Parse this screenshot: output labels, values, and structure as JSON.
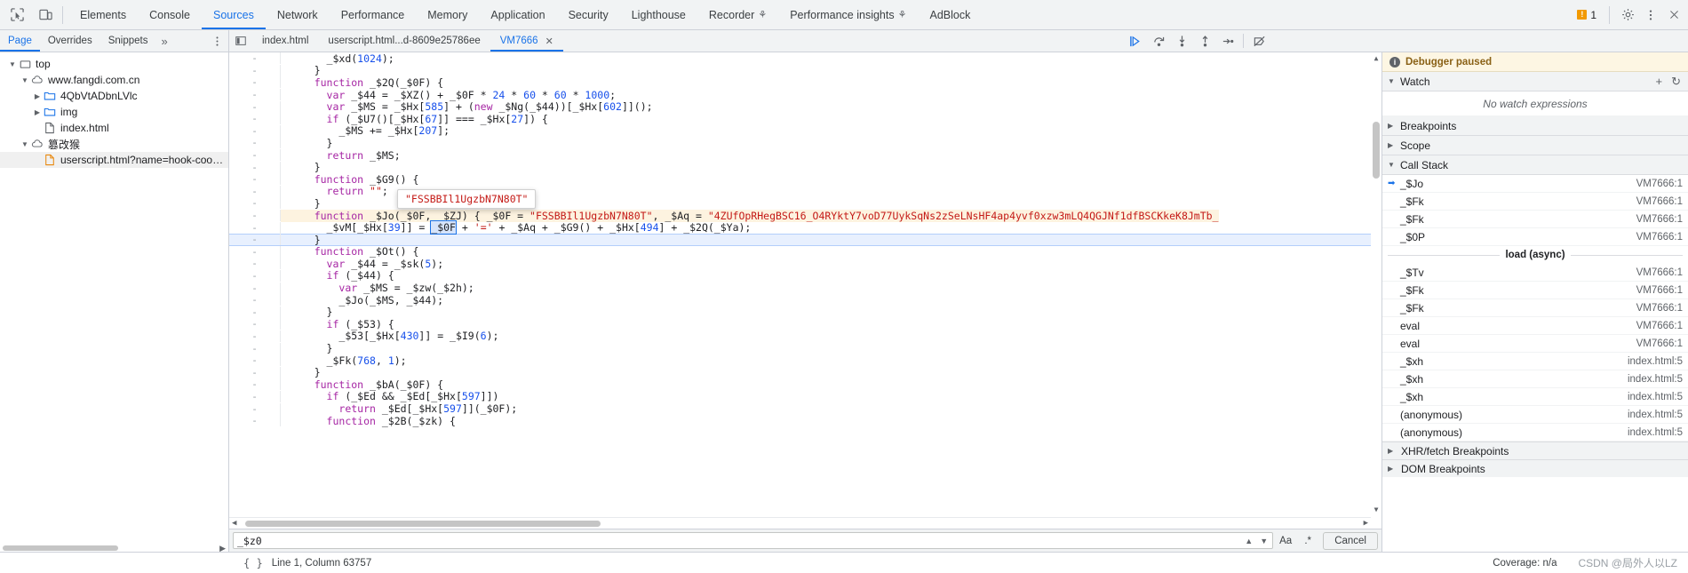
{
  "topbar": {
    "inspect_icon": "inspect-element-icon",
    "device_icon": "device-toolbar-icon",
    "tabs": [
      {
        "label": "Elements",
        "active": false,
        "flask": false
      },
      {
        "label": "Console",
        "active": false,
        "flask": false
      },
      {
        "label": "Sources",
        "active": true,
        "flask": false
      },
      {
        "label": "Network",
        "active": false,
        "flask": false
      },
      {
        "label": "Performance",
        "active": false,
        "flask": false
      },
      {
        "label": "Memory",
        "active": false,
        "flask": false
      },
      {
        "label": "Application",
        "active": false,
        "flask": false
      },
      {
        "label": "Security",
        "active": false,
        "flask": false
      },
      {
        "label": "Lighthouse",
        "active": false,
        "flask": false
      },
      {
        "label": "Recorder",
        "active": false,
        "flask": true
      },
      {
        "label": "Performance insights",
        "active": false,
        "flask": true
      },
      {
        "label": "AdBlock",
        "active": false,
        "flask": false
      }
    ],
    "warning_count": "1",
    "settings_icon": "gear-icon",
    "more_icon": "kebab-menu-icon",
    "close_icon": "close-icon"
  },
  "subbar": {
    "nav_tabs": [
      {
        "label": "Page",
        "active": true
      },
      {
        "label": "Overrides",
        "active": false
      },
      {
        "label": "Snippets",
        "active": false
      }
    ],
    "more_tabs_label": "»",
    "kebab_icon": "kebab-menu-icon",
    "panel_toggle_icon": "show-navigator-icon",
    "editor_tabs": [
      {
        "label": "index.html",
        "active": false,
        "closable": false
      },
      {
        "label": "userscript.html...d-8609e25786ee",
        "active": false,
        "closable": false
      },
      {
        "label": "VM7666",
        "active": true,
        "closable": true
      }
    ],
    "close_tab_glyph": "✕",
    "debug_controls": [
      {
        "name": "resume-script-execution",
        "glyph": "▷"
      },
      {
        "name": "step-over-next-function-call",
        "glyph": "↷"
      },
      {
        "name": "step-into-next-function-call",
        "glyph": "↓"
      },
      {
        "name": "step-out-of-current-function",
        "glyph": "↑"
      },
      {
        "name": "step",
        "glyph": "→"
      },
      {
        "name": "deactivate-breakpoints",
        "glyph": "⊘"
      }
    ]
  },
  "navigator": {
    "tree": [
      {
        "label": "top",
        "depth": 0,
        "twisty": "open",
        "icon": "frame-icon",
        "selected": false
      },
      {
        "label": "www.fangdi.com.cn",
        "depth": 1,
        "twisty": "open",
        "icon": "cloud-icon",
        "selected": false
      },
      {
        "label": "4QbVtADbnLVlc",
        "depth": 2,
        "twisty": "closed",
        "icon": "folder-icon",
        "selected": false
      },
      {
        "label": "img",
        "depth": 2,
        "twisty": "closed",
        "icon": "folder-icon",
        "selected": false
      },
      {
        "label": "index.html",
        "depth": 2,
        "twisty": "none",
        "icon": "document-icon",
        "selected": false
      },
      {
        "label": "篡改猴",
        "depth": 1,
        "twisty": "open",
        "icon": "cloud-icon",
        "selected": false
      },
      {
        "label": "userscript.html?name=hook-cookie.user.j",
        "depth": 2,
        "twisty": "none",
        "icon": "script-icon-orange",
        "selected": true
      }
    ]
  },
  "editor": {
    "coverage_marker": "-",
    "tooltip_value": "\"FSSBBIl1UgzbN7N80T\"",
    "lines": [
      {
        "indent": 6,
        "tokens": [
          {
            "t": "_$xd(",
            "c": "plain"
          },
          {
            "t": "1024",
            "c": "num"
          },
          {
            "t": ");",
            "c": "plain"
          }
        ]
      },
      {
        "indent": 4,
        "tokens": [
          {
            "t": "}",
            "c": "plain"
          }
        ]
      },
      {
        "indent": 4,
        "tokens": [
          {
            "t": "function ",
            "c": "kw"
          },
          {
            "t": "_$2Q(_$0F) {",
            "c": "plain"
          }
        ]
      },
      {
        "indent": 6,
        "tokens": [
          {
            "t": "var ",
            "c": "kw"
          },
          {
            "t": "_$44 = _$XZ() + _$0F * ",
            "c": "plain"
          },
          {
            "t": "24",
            "c": "num"
          },
          {
            "t": " * ",
            "c": "plain"
          },
          {
            "t": "60",
            "c": "num"
          },
          {
            "t": " * ",
            "c": "plain"
          },
          {
            "t": "60",
            "c": "num"
          },
          {
            "t": " * ",
            "c": "plain"
          },
          {
            "t": "1000",
            "c": "num"
          },
          {
            "t": ";",
            "c": "plain"
          }
        ]
      },
      {
        "indent": 6,
        "tokens": [
          {
            "t": "var ",
            "c": "kw"
          },
          {
            "t": "_$MS = _$Hx[",
            "c": "plain"
          },
          {
            "t": "585",
            "c": "num"
          },
          {
            "t": "] + (",
            "c": "plain"
          },
          {
            "t": "new ",
            "c": "kw"
          },
          {
            "t": "_$Ng(_$44))[_$Hx[",
            "c": "plain"
          },
          {
            "t": "602",
            "c": "num"
          },
          {
            "t": "]]();",
            "c": "plain"
          }
        ]
      },
      {
        "indent": 6,
        "tokens": [
          {
            "t": "if ",
            "c": "kw"
          },
          {
            "t": "(_$U7()[_$Hx[",
            "c": "plain"
          },
          {
            "t": "67",
            "c": "num"
          },
          {
            "t": "]] === _$Hx[",
            "c": "plain"
          },
          {
            "t": "27",
            "c": "num"
          },
          {
            "t": "]) {",
            "c": "plain"
          }
        ]
      },
      {
        "indent": 8,
        "tokens": [
          {
            "t": "_$MS += _$Hx[",
            "c": "plain"
          },
          {
            "t": "207",
            "c": "num"
          },
          {
            "t": "];",
            "c": "plain"
          }
        ]
      },
      {
        "indent": 6,
        "tokens": [
          {
            "t": "}",
            "c": "plain"
          }
        ]
      },
      {
        "indent": 6,
        "tokens": [
          {
            "t": "return ",
            "c": "kw"
          },
          {
            "t": "_$MS;",
            "c": "plain"
          }
        ]
      },
      {
        "indent": 4,
        "tokens": [
          {
            "t": "}",
            "c": "plain"
          }
        ]
      },
      {
        "indent": 4,
        "tokens": [
          {
            "t": "function ",
            "c": "kw"
          },
          {
            "t": "_$G9() {",
            "c": "plain"
          }
        ]
      },
      {
        "indent": 6,
        "tokens": [
          {
            "t": "return ",
            "c": "kw"
          },
          {
            "t": "\"\"",
            "c": "str"
          },
          {
            "t": ";",
            "c": "plain"
          }
        ]
      },
      {
        "indent": 4,
        "tokens": [
          {
            "t": "}",
            "c": "plain"
          }
        ]
      },
      {
        "indent": 4,
        "tokens": [
          {
            "t": "function ",
            "c": "kw"
          },
          {
            "t": "_$Jo(_$0F, _$ZJ) { _$0F = ",
            "c": "plain"
          },
          {
            "t": "\"FSSBBIl1UgzbN7N80T\"",
            "c": "str"
          },
          {
            "t": ", _$Aq = ",
            "c": "plain"
          },
          {
            "t": "\"4ZUfOpRHegBSC16_O4RYktY7voD77UykSqNs2zSeLNsHF4ap4yvf0xzw3mLQ4QGJNf1dfBSCKkeK8JmTb_",
            "c": "str"
          }
        ]
      },
      {
        "indent": 6,
        "tokens": [
          {
            "t": "_$vM[_$Hx[",
            "c": "plain"
          },
          {
            "t": "39",
            "c": "num"
          },
          {
            "t": "]] = ",
            "c": "plain"
          },
          {
            "t": "_$0F",
            "c": "boxsel"
          },
          {
            "t": " + ",
            "c": "plain"
          },
          {
            "t": "'='",
            "c": "str"
          },
          {
            "t": " + _$Aq + _$G9() + _$Hx[",
            "c": "plain"
          },
          {
            "t": "494",
            "c": "num"
          },
          {
            "t": "] + _$2Q(_$Ya);",
            "c": "plain"
          }
        ]
      },
      {
        "indent": 4,
        "tokens": [
          {
            "t": "}",
            "c": "plain"
          }
        ],
        "highlight": true
      },
      {
        "indent": 4,
        "tokens": [
          {
            "t": "function ",
            "c": "kw"
          },
          {
            "t": "_$Ot() {",
            "c": "plain"
          }
        ]
      },
      {
        "indent": 6,
        "tokens": [
          {
            "t": "var ",
            "c": "kw"
          },
          {
            "t": "_$44 = _$sk(",
            "c": "plain"
          },
          {
            "t": "5",
            "c": "num"
          },
          {
            "t": ");",
            "c": "plain"
          }
        ]
      },
      {
        "indent": 6,
        "tokens": [
          {
            "t": "if ",
            "c": "kw"
          },
          {
            "t": "(_$44) {",
            "c": "plain"
          }
        ]
      },
      {
        "indent": 8,
        "tokens": [
          {
            "t": "var ",
            "c": "kw"
          },
          {
            "t": "_$MS = _$zw(_$2h);",
            "c": "plain"
          }
        ]
      },
      {
        "indent": 8,
        "tokens": [
          {
            "t": "_$Jo(_$MS, _$44);",
            "c": "plain"
          }
        ]
      },
      {
        "indent": 6,
        "tokens": [
          {
            "t": "}",
            "c": "plain"
          }
        ]
      },
      {
        "indent": 6,
        "tokens": [
          {
            "t": "if ",
            "c": "kw"
          },
          {
            "t": "(_$53) {",
            "c": "plain"
          }
        ]
      },
      {
        "indent": 8,
        "tokens": [
          {
            "t": "_$53[_$Hx[",
            "c": "plain"
          },
          {
            "t": "430",
            "c": "num"
          },
          {
            "t": "]] = _$I9(",
            "c": "plain"
          },
          {
            "t": "6",
            "c": "num"
          },
          {
            "t": ");",
            "c": "plain"
          }
        ]
      },
      {
        "indent": 6,
        "tokens": [
          {
            "t": "}",
            "c": "plain"
          }
        ]
      },
      {
        "indent": 6,
        "tokens": [
          {
            "t": "_$Fk(",
            "c": "plain"
          },
          {
            "t": "768",
            "c": "num"
          },
          {
            "t": ", ",
            "c": "plain"
          },
          {
            "t": "1",
            "c": "num"
          },
          {
            "t": ");",
            "c": "plain"
          }
        ]
      },
      {
        "indent": 4,
        "tokens": [
          {
            "t": "}",
            "c": "plain"
          }
        ]
      },
      {
        "indent": 4,
        "tokens": [
          {
            "t": "function ",
            "c": "kw"
          },
          {
            "t": "_$bA(_$0F) {",
            "c": "plain"
          }
        ]
      },
      {
        "indent": 6,
        "tokens": [
          {
            "t": "if ",
            "c": "kw"
          },
          {
            "t": "(_$Ed && _$Ed[_$Hx[",
            "c": "plain"
          },
          {
            "t": "597",
            "c": "num"
          },
          {
            "t": "]])",
            "c": "plain"
          }
        ]
      },
      {
        "indent": 8,
        "tokens": [
          {
            "t": "return ",
            "c": "kw"
          },
          {
            "t": "_$Ed[_$Hx[",
            "c": "plain"
          },
          {
            "t": "597",
            "c": "num"
          },
          {
            "t": "]](_$0F);",
            "c": "plain"
          }
        ]
      },
      {
        "indent": 6,
        "tokens": [
          {
            "t": "function ",
            "c": "kw"
          },
          {
            "t": "_$2B(_$zk) {",
            "c": "plain"
          }
        ]
      }
    ]
  },
  "search": {
    "value": "_$z0",
    "prev_icon": "chevron-up-icon",
    "next_icon": "chevron-down-icon",
    "match_case_label": "Aa",
    "regex_label": ".*",
    "cancel_label": "Cancel"
  },
  "debugger": {
    "paused_label": "Debugger paused",
    "watch": {
      "title": "Watch",
      "add_icon": "plus-icon",
      "refresh_icon": "refresh-icon",
      "empty": "No watch expressions"
    },
    "breakpoints_title": "Breakpoints",
    "scope_title": "Scope",
    "callstack_title": "Call Stack",
    "callstack": [
      {
        "name": "_$Jo",
        "location": "VM7666:1",
        "selected": true
      },
      {
        "name": "_$Fk",
        "location": "VM7666:1",
        "selected": false
      },
      {
        "name": "_$Fk",
        "location": "VM7666:1",
        "selected": false
      },
      {
        "name": "_$0P",
        "location": "VM7666:1",
        "selected": false
      },
      {
        "name": "load (async)",
        "location": "",
        "separator": true
      },
      {
        "name": "_$Tv",
        "location": "VM7666:1",
        "selected": false
      },
      {
        "name": "_$Fk",
        "location": "VM7666:1",
        "selected": false
      },
      {
        "name": "_$Fk",
        "location": "VM7666:1",
        "selected": false
      },
      {
        "name": "eval",
        "location": "VM7666:1",
        "selected": false
      },
      {
        "name": "eval",
        "location": "VM7666:1",
        "selected": false
      },
      {
        "name": "_$xh",
        "location": "index.html:5",
        "selected": false
      },
      {
        "name": "_$xh",
        "location": "index.html:5",
        "selected": false
      },
      {
        "name": "_$xh",
        "location": "index.html:5",
        "selected": false
      },
      {
        "name": "(anonymous)",
        "location": "index.html:5",
        "selected": false
      },
      {
        "name": "(anonymous)",
        "location": "index.html:5",
        "selected": false
      }
    ],
    "xhr_breakpoints_title": "XHR/fetch Breakpoints",
    "dom_breakpoints_title": "DOM Breakpoints"
  },
  "statusbar": {
    "format_icon": "pretty-print-icon",
    "position": "Line 1, Column 63757",
    "coverage": "Coverage: n/a"
  },
  "watermark": "CSDN @局外人以LZ"
}
